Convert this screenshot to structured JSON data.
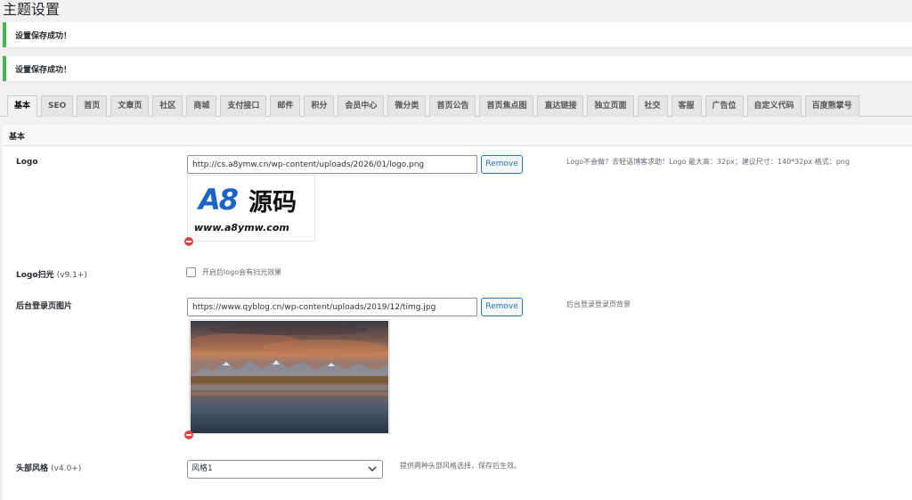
{
  "page": {
    "title": "主题设置"
  },
  "notices": [
    {
      "text": "设置保存成功！"
    },
    {
      "text": "设置保存成功！"
    }
  ],
  "tabs": [
    "基本",
    "SEO",
    "首页",
    "文章页",
    "社区",
    "商城",
    "支付接口",
    "邮件",
    "积分",
    "会员中心",
    "微分类",
    "首页公告",
    "首页焦点图",
    "直达链接",
    "独立页面",
    "社交",
    "客服",
    "广告位",
    "自定义代码",
    "百度熊掌号"
  ],
  "active_tab": "基本",
  "section": {
    "title": "基本"
  },
  "fields": {
    "logo": {
      "label": "Logo",
      "value": "http://cs.a8ymw.cn/wp-content/uploads/2026/01/logo.png",
      "remove_label": "Remove",
      "description": "Logo不会做？去轻语博客求助！Logo 最大高：32px；建议尺寸：140*32px 格式：png",
      "preview": {
        "brand_a8": "A8",
        "brand_cn": "源码",
        "brand_url": "www.a8ymw.com"
      }
    },
    "logo_shine": {
      "label": "Logo扫光",
      "version": "(v9.1+)",
      "checkbox_label": "开启后logo会有扫光效果",
      "checked": false
    },
    "login_bg": {
      "label": "后台登录页图片",
      "value": "https://www.qyblog.cn/wp-content/uploads/2019/12/timg.jpg",
      "remove_label": "Remove",
      "description": "后台登录登录页背景"
    },
    "header_style": {
      "label": "头部风格",
      "version": "(v4.0+)",
      "selected": "风格1",
      "description": "提供两种头部风格选择，保存后生效。"
    }
  },
  "colors": {
    "notice_accent": "#46b450",
    "link": "#2271b1",
    "delete": "#e0443e",
    "logo_blue": "#1a63c8"
  },
  "icons": {
    "delete": "remove-circle-icon",
    "select": "chevron-down-icon"
  }
}
